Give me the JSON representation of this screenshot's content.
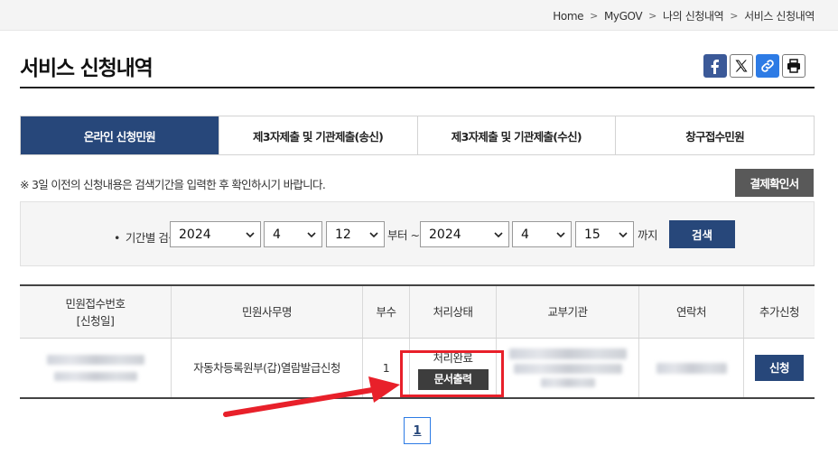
{
  "breadcrumb": [
    "Home",
    "MyGOV",
    "나의 신청내역",
    "서비스 신청내역"
  ],
  "page_title": "서비스 신청내역",
  "share": {
    "facebook": "facebook-icon",
    "x": "x-icon",
    "link": "link-icon",
    "print": "print-icon"
  },
  "tabs": [
    {
      "label": "온라인 신청민원",
      "active": true
    },
    {
      "label": "제3자제출 및 기관제출(송신)",
      "active": false
    },
    {
      "label": "제3자제출 및 기관제출(수신)",
      "active": false
    },
    {
      "label": "창구접수민원",
      "active": false
    }
  ],
  "notice": "※ 3일 이전의 신청내용은 검색기간을 입력한 후 확인하시기 바랍니다.",
  "receipt_button": "결제확인서",
  "search": {
    "label": "기간별 검색",
    "from_year": "2024",
    "from_month": "4",
    "from_day": "12",
    "from_suffix": "부터 ~",
    "to_year": "2024",
    "to_month": "4",
    "to_day": "15",
    "to_suffix": "까지",
    "button": "검색"
  },
  "table": {
    "headers": [
      "민원접수번호",
      "[신청일]",
      "민원사무명",
      "부수",
      "처리상태",
      "교부기관",
      "연락처",
      "추가신청"
    ],
    "rows": [
      {
        "service_name": "자동차등록원부(갑)열람발급신청",
        "copies": "1",
        "status": "처리완료",
        "print_button": "문서출력",
        "apply_button": "신청"
      }
    ]
  },
  "pagination": {
    "current": "1"
  },
  "colors": {
    "accent": "#27477a",
    "highlight": "#e8202a"
  }
}
